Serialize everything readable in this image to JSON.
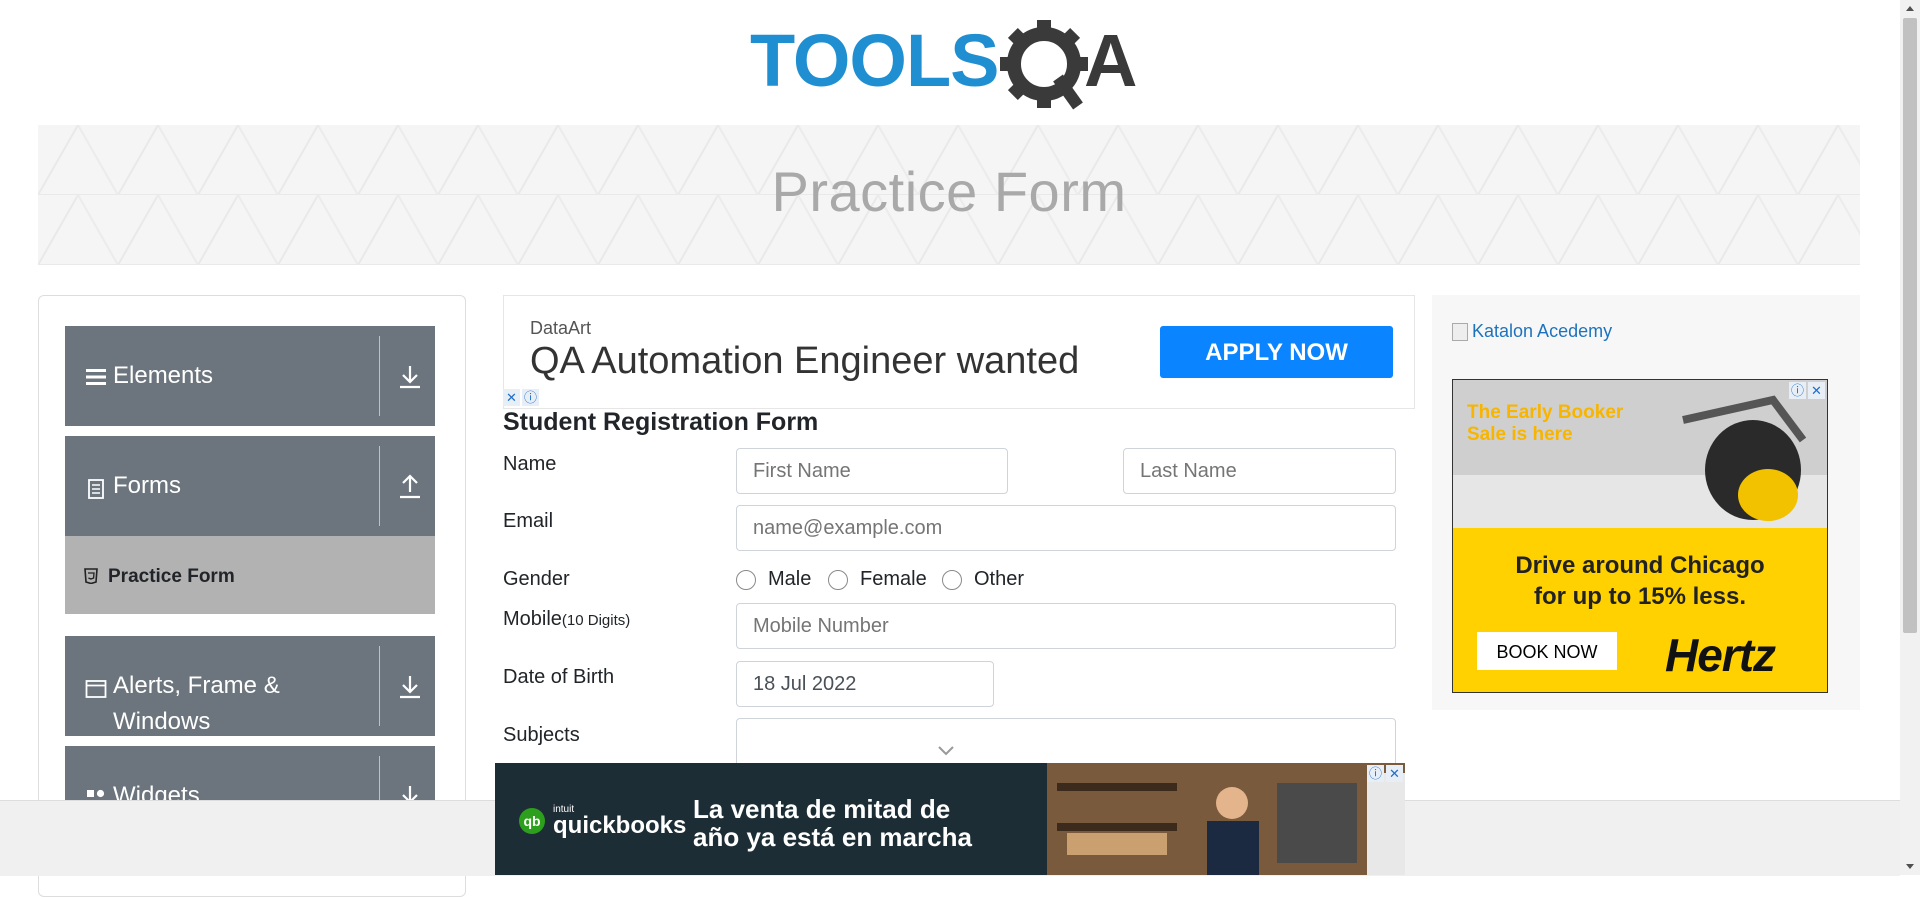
{
  "header": {
    "logo_text": "TOOLSQA"
  },
  "banner": {
    "title": "Practice Form"
  },
  "sidebar": {
    "groups": [
      {
        "label": "Elements",
        "icon": "hamburger-icon",
        "arrow": "download-icon"
      },
      {
        "label": "Forms",
        "icon": "document-icon",
        "arrow": "upload-icon"
      },
      {
        "label": "Alerts, Frame &",
        "label2": "Windows",
        "icon": "window-icon",
        "arrow": "download-icon"
      },
      {
        "label": "Widgets",
        "icon": "widgets-icon",
        "arrow": "download-icon"
      }
    ],
    "active_item": {
      "label": "Practice Form",
      "icon": "html5-icon"
    }
  },
  "ad_top": {
    "brand": "DataArt",
    "headline": "QA Automation Engineer wanted",
    "button": "APPLY NOW"
  },
  "form": {
    "title": "Student Registration Form",
    "name_label": "Name",
    "first_name_placeholder": "First Name",
    "last_name_placeholder": "Last Name",
    "email_label": "Email",
    "email_placeholder": "name@example.com",
    "gender_label": "Gender",
    "gender_options": [
      "Male",
      "Female",
      "Other"
    ],
    "mobile_label": "Mobile",
    "mobile_hint": "(10 Digits)",
    "mobile_placeholder": "Mobile Number",
    "dob_label": "Date of Birth",
    "dob_value": "18 Jul 2022",
    "subjects_label": "Subjects"
  },
  "ad_right": {
    "katalon_alt": "Katalon Acedemy",
    "hertz": {
      "promo": "The Early Booker Sale is here",
      "line1": "Drive around Chicago",
      "line2": "for up to 15% less.",
      "button": "BOOK NOW",
      "brand": "Hertz"
    }
  },
  "ad_bottom": {
    "brand_small": "intuit",
    "brand": "quickbooks",
    "line1": "La venta de mitad de",
    "line2": "año ya está en marcha"
  },
  "colors": {
    "logo_blue": "#1f8fd1",
    "logo_dark": "#3a3a3a",
    "sidebar_group": "#6c757d",
    "sidebar_active": "#b2b2b2",
    "apply_button": "#0a84ff",
    "hertz_yellow": "#ffd100",
    "quickbooks_green": "#2ca01c"
  }
}
